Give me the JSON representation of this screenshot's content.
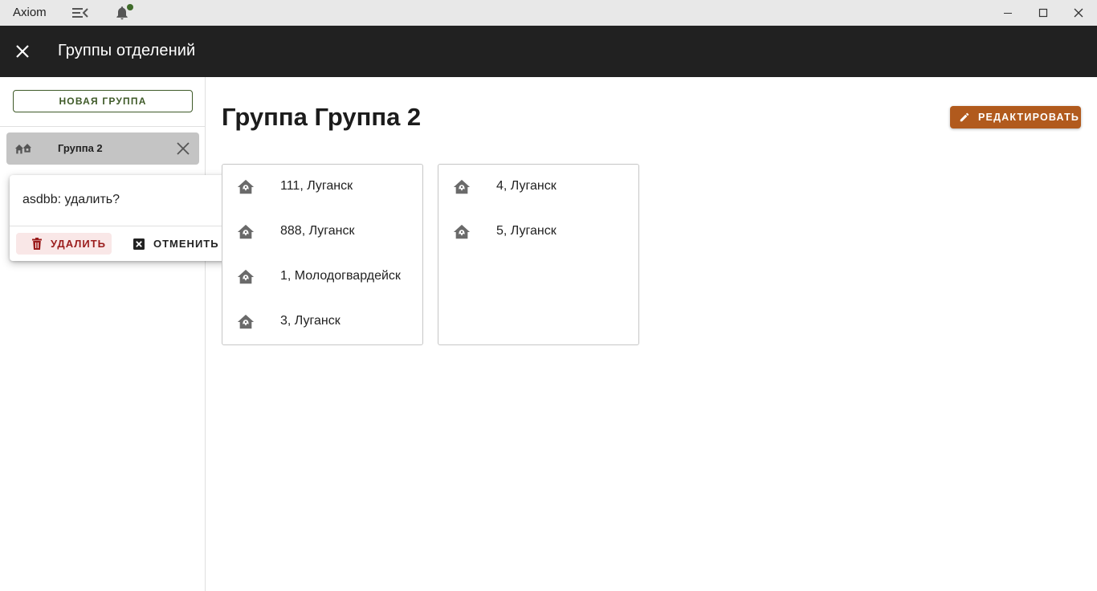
{
  "titlebar": {
    "app_name": "Axiom"
  },
  "header": {
    "title": "Группы отделений"
  },
  "sidebar": {
    "new_group_label": "НОВАЯ ГРУППА",
    "groups": [
      {
        "label": "Группа 2"
      }
    ]
  },
  "confirm": {
    "text": "asdbb: удалить?",
    "delete_label": "УДАЛИТЬ",
    "cancel_label": "ОТМЕНИТЬ"
  },
  "main": {
    "title": "Группа Группа 2",
    "edit_label": "РЕДАКТИРОВАТЬ",
    "columns": [
      {
        "items": [
          {
            "label": "111, Луганск"
          },
          {
            "label": "888, Луганск"
          },
          {
            "label": "1, Молодогвардейск"
          },
          {
            "label": "3, Луганск"
          }
        ]
      },
      {
        "items": [
          {
            "label": "4, Луганск"
          },
          {
            "label": "5, Луганск"
          }
        ]
      }
    ]
  },
  "colors": {
    "header_bg": "#212121",
    "accent_green": "#3f5a28",
    "edit_button": "#b15a1d",
    "delete_text": "#9b1c1c",
    "notification_dot": "#3f6b2a"
  },
  "icons": {
    "branch": "branch-house-icon",
    "group": "homes-icon"
  }
}
